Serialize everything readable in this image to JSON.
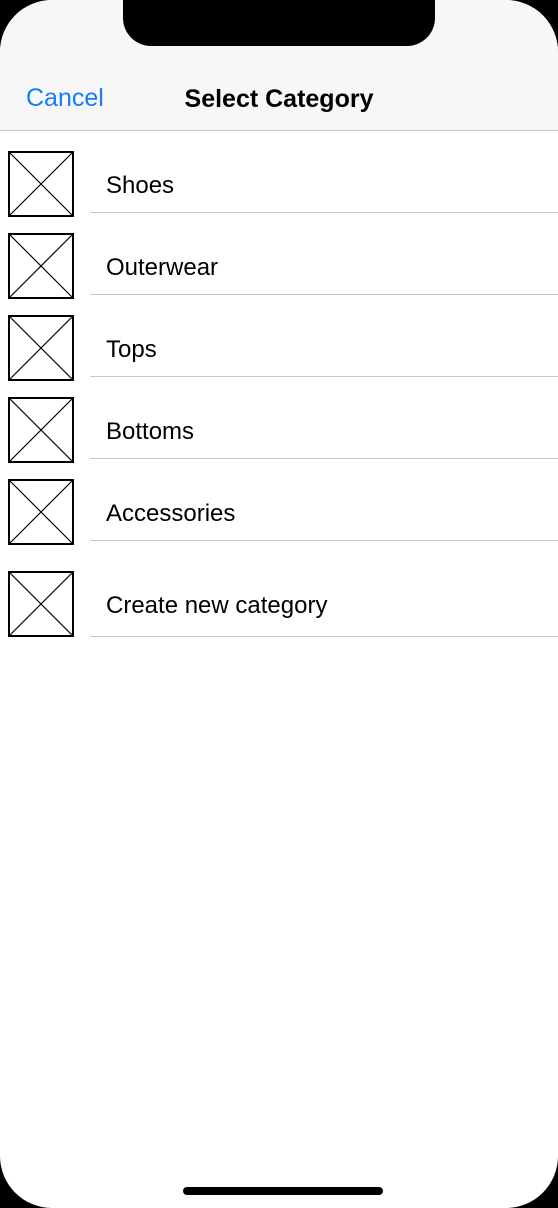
{
  "nav": {
    "cancel_label": "Cancel",
    "title": "Select Category"
  },
  "categories": [
    {
      "label": "Shoes",
      "icon": "image-placeholder-icon"
    },
    {
      "label": "Outerwear",
      "icon": "image-placeholder-icon"
    },
    {
      "label": "Tops",
      "icon": "image-placeholder-icon"
    },
    {
      "label": "Bottoms",
      "icon": "image-placeholder-icon"
    },
    {
      "label": "Accessories",
      "icon": "image-placeholder-icon"
    }
  ],
  "create_new": {
    "label": "Create new category",
    "icon": "image-placeholder-icon"
  },
  "colors": {
    "accent": "#1a7cf2",
    "nav_background": "#f7f7f7",
    "separator": "#c8c8cc"
  }
}
